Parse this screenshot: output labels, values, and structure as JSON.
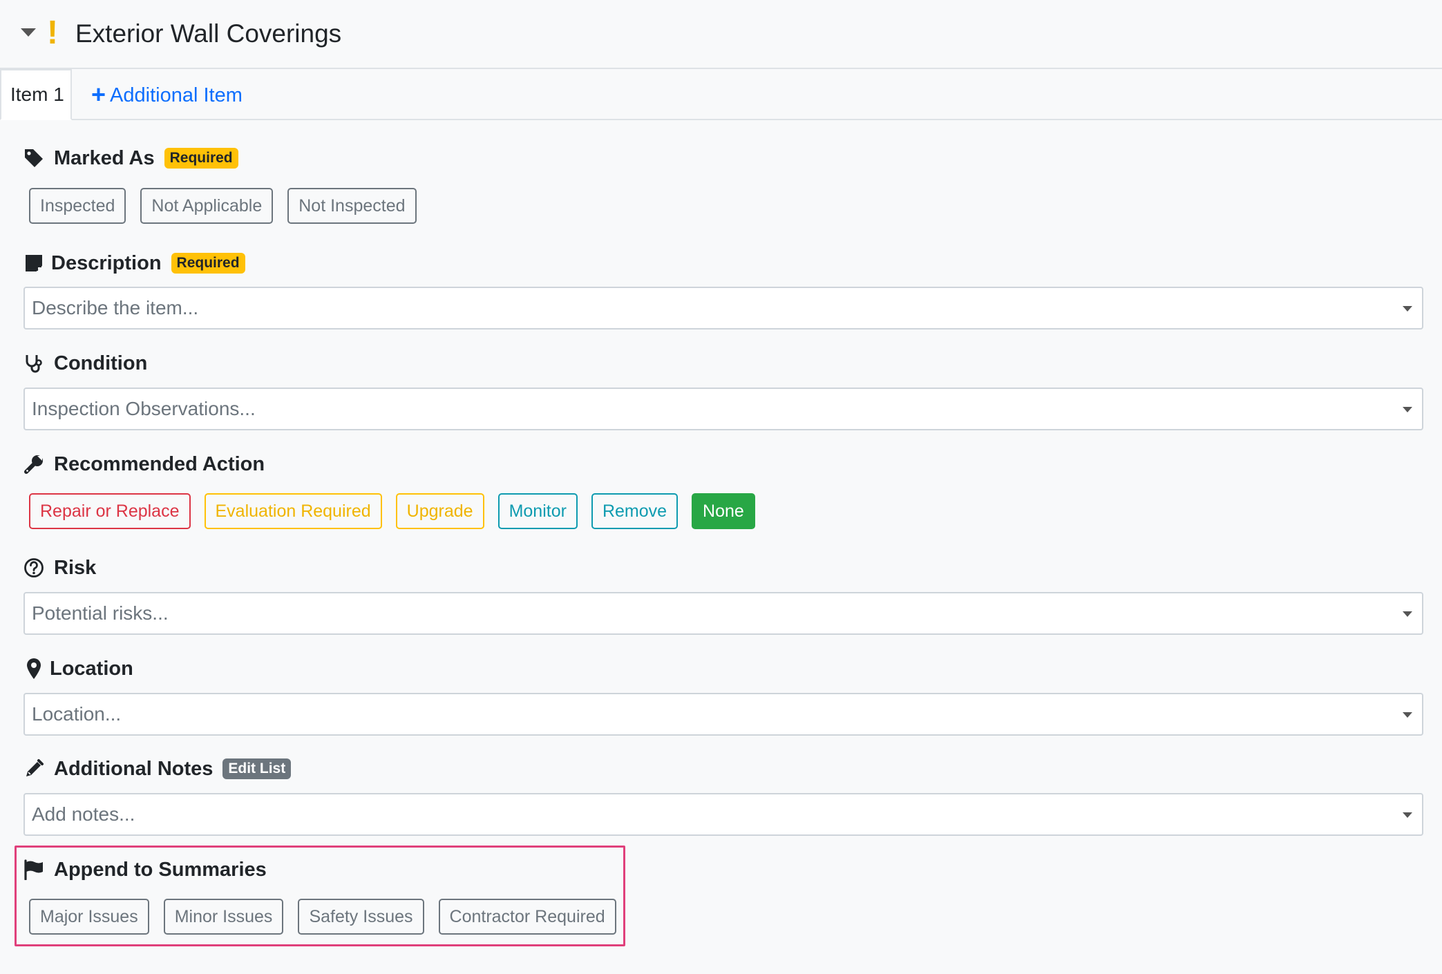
{
  "header": {
    "title": "Exterior Wall Coverings",
    "alert_glyph": "!"
  },
  "tabs": {
    "active_label": "Item 1",
    "add_label": "Additional Item",
    "add_glyph": "+"
  },
  "marked_as": {
    "label": "Marked As",
    "badge": "Required",
    "options": [
      "Inspected",
      "Not Applicable",
      "Not Inspected"
    ]
  },
  "description": {
    "label": "Description",
    "badge": "Required",
    "placeholder": "Describe the item..."
  },
  "condition": {
    "label": "Condition",
    "placeholder": "Inspection Observations..."
  },
  "recommended_action": {
    "label": "Recommended Action",
    "options": [
      "Repair or Replace",
      "Evaluation Required",
      "Upgrade",
      "Monitor",
      "Remove",
      "None"
    ]
  },
  "risk": {
    "label": "Risk",
    "placeholder": "Potential risks..."
  },
  "location": {
    "label": "Location",
    "placeholder": "Location..."
  },
  "additional_notes": {
    "label": "Additional Notes",
    "badge": "Edit List",
    "placeholder": "Add notes..."
  },
  "summaries": {
    "label": "Append to Summaries",
    "options": [
      "Major Issues",
      "Minor Issues",
      "Safety Issues",
      "Contractor Required"
    ]
  },
  "colors": {
    "required_badge": "#ffc107",
    "edit_badge": "#6c757d",
    "link": "#0d6efd",
    "danger": "#dc3545",
    "warning": "#ffc107",
    "info": "#0e9bb0",
    "success": "#28a745",
    "highlight": "#e0407b"
  }
}
